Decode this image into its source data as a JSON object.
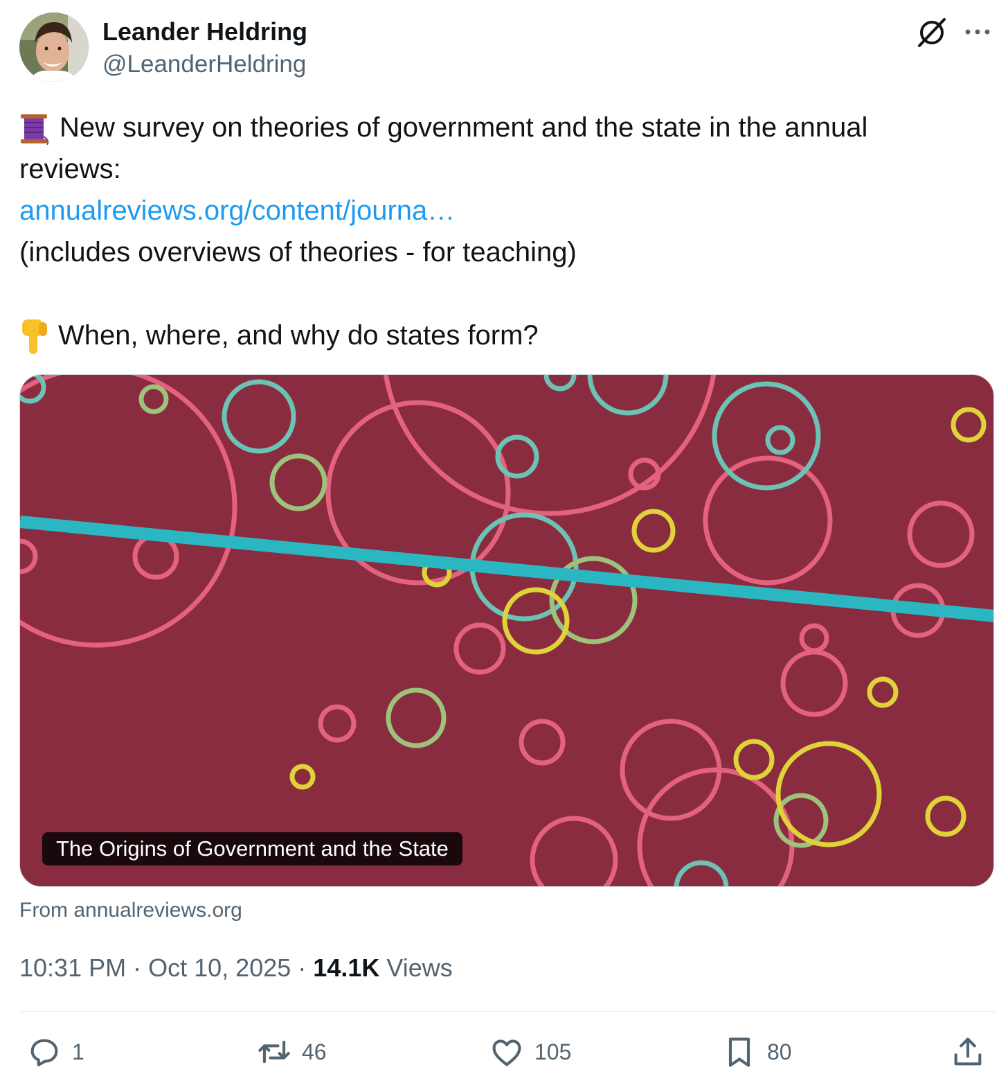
{
  "author": {
    "display_name": "Leander Heldring",
    "handle": "@LeanderHeldring"
  },
  "tweet": {
    "line1_emoji": "thread-spool-icon",
    "line1": "New survey on theories of government and the state in the annual",
    "line2": "reviews:",
    "link_text": "annualreviews.org/content/journa…",
    "line4": "(includes overviews of theories - for teaching)",
    "line5_emoji": "pointing-down-icon",
    "line5": "When, where, and why do states form?"
  },
  "card": {
    "title": "The Origins of Government and the State",
    "source": "From annualreviews.org",
    "colors": {
      "background": "#8a2c3f",
      "pink": "#e4627e",
      "teal": "#6cc3b5",
      "green": "#9dc27a",
      "yellow": "#e0d33a",
      "stripe": "#2bb7c2"
    }
  },
  "meta": {
    "time": "10:31 PM",
    "separator": "·",
    "date": "Oct 10, 2025",
    "views_count": "14.1K",
    "views_label": "Views"
  },
  "actions": {
    "reply": "1",
    "retweet": "46",
    "like": "105",
    "bookmark": "80"
  },
  "icons": [
    "grok-icon",
    "more-icon",
    "reply-icon",
    "retweet-icon",
    "like-icon",
    "bookmark-icon",
    "share-icon"
  ]
}
